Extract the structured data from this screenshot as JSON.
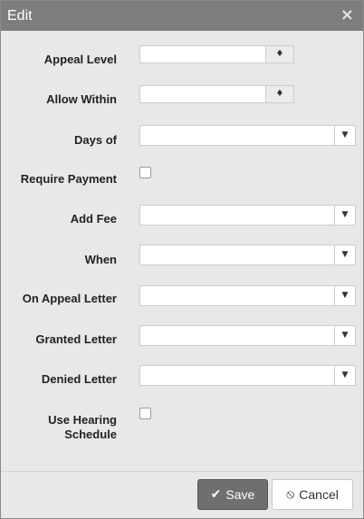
{
  "dialog": {
    "title": "Edit",
    "close_icon": "×"
  },
  "fields": {
    "appeal_level": {
      "label": "Appeal Level",
      "value": ""
    },
    "allow_within": {
      "label": "Allow Within",
      "value": ""
    },
    "days_of": {
      "label": "Days of",
      "value": ""
    },
    "require_payment": {
      "label": "Require Payment",
      "checked": false
    },
    "add_fee": {
      "label": "Add Fee",
      "value": ""
    },
    "when": {
      "label": "When",
      "value": ""
    },
    "on_appeal_letter": {
      "label": "On Appeal Letter",
      "value": ""
    },
    "granted_letter": {
      "label": "Granted Letter",
      "value": ""
    },
    "denied_letter": {
      "label": "Denied Letter",
      "value": ""
    },
    "use_hearing_schedule": {
      "label_line1": "Use Hearing",
      "label_line2": "Schedule",
      "checked": false
    }
  },
  "icons": {
    "spinner": "♦",
    "dropdown": "▼",
    "check": "✔",
    "ban": "⦸"
  },
  "footer": {
    "save_label": "Save",
    "cancel_label": "Cancel"
  },
  "colors": {
    "titlebar": "#7d7d7d",
    "dialog_bg": "#e8e8e8",
    "save_button": "#6f6f6f"
  }
}
